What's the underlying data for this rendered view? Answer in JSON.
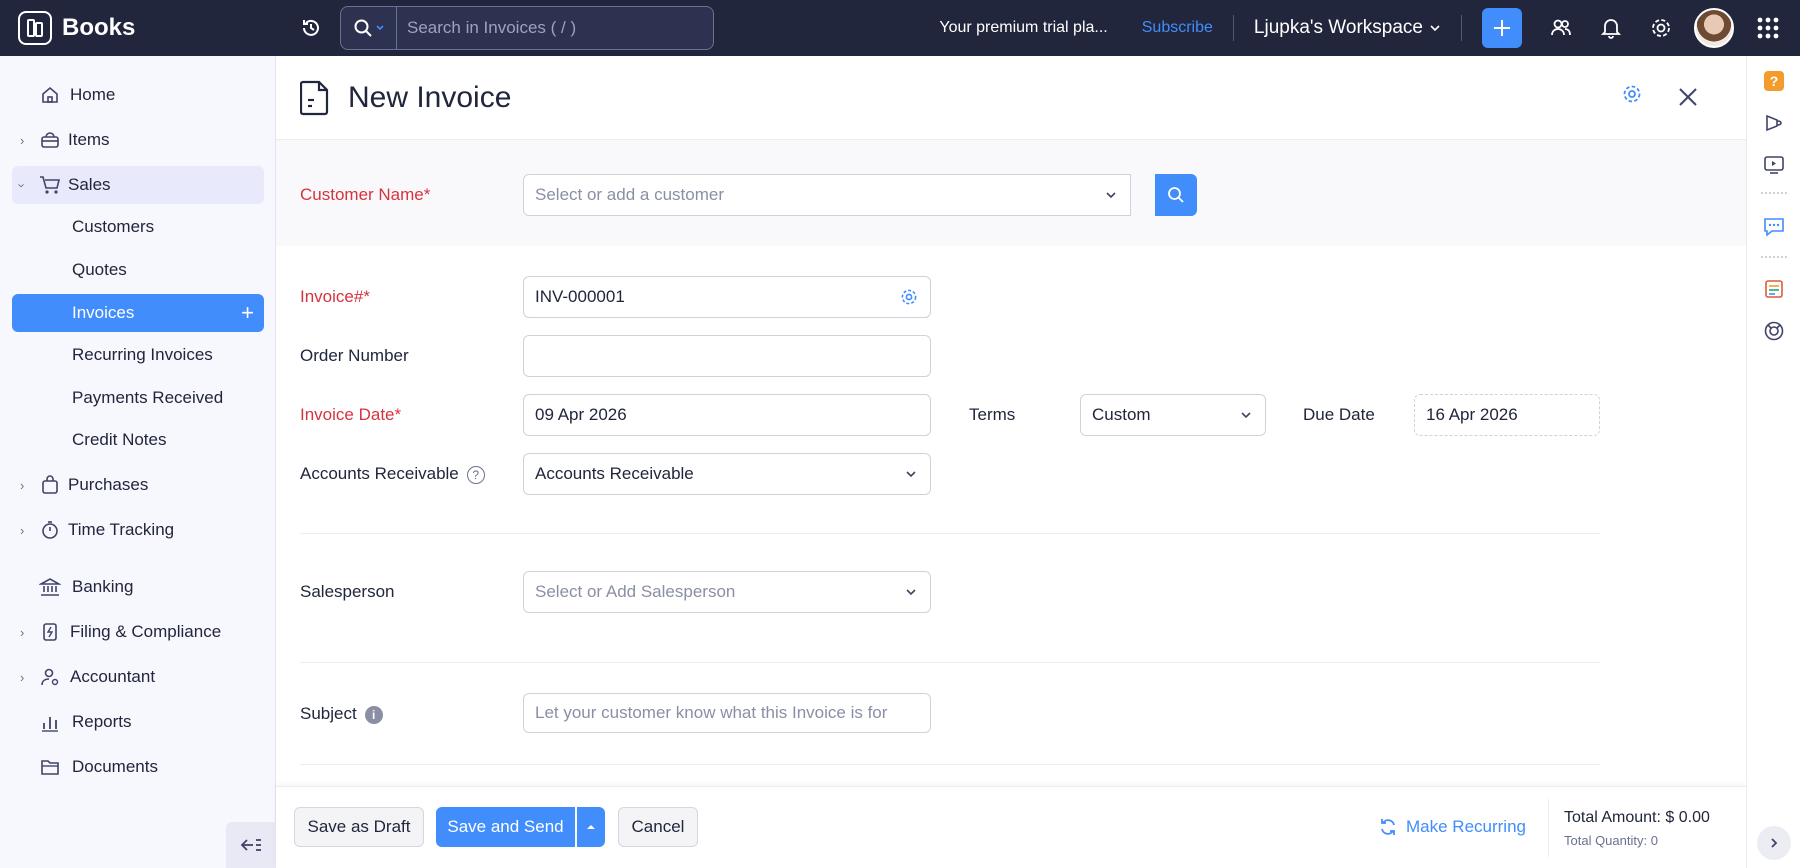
{
  "topbar": {
    "brand": "Books",
    "search_placeholder": "Search in Invoices ( / )",
    "trial_text": "Your premium trial pla...",
    "subscribe": "Subscribe",
    "workspace": "Ljupka's Workspace"
  },
  "sidebar": {
    "home": "Home",
    "items": "Items",
    "sales": "Sales",
    "customers": "Customers",
    "quotes": "Quotes",
    "invoices": "Invoices",
    "recurring_invoices": "Recurring Invoices",
    "payments_received": "Payments Received",
    "credit_notes": "Credit Notes",
    "purchases": "Purchases",
    "time_tracking": "Time Tracking",
    "banking": "Banking",
    "filing": "Filing & Compliance",
    "accountant": "Accountant",
    "reports": "Reports",
    "documents": "Documents"
  },
  "page": {
    "title": "New Invoice"
  },
  "form": {
    "customer_label": "Customer Name*",
    "customer_placeholder": "Select or add a customer",
    "invoice_no_label": "Invoice#*",
    "invoice_no_value": "INV-000001",
    "order_number_label": "Order Number",
    "order_number_value": "",
    "invoice_date_label": "Invoice Date*",
    "invoice_date_value": "09 Apr 2026",
    "terms_label": "Terms",
    "terms_value": "Custom",
    "due_date_label": "Due Date",
    "due_date_value": "16 Apr 2026",
    "ar_label": "Accounts Receivable",
    "ar_value": "Accounts Receivable",
    "salesperson_label": "Salesperson",
    "salesperson_placeholder": "Select or Add Salesperson",
    "subject_label": "Subject",
    "subject_placeholder": "Let your customer know what this Invoice is for"
  },
  "footer": {
    "save_draft": "Save as Draft",
    "save_send": "Save and Send",
    "cancel": "Cancel",
    "make_recurring": "Make Recurring",
    "total_amount": "Total Amount: $ 0.00",
    "total_quantity": "Total Quantity: 0"
  },
  "colors": {
    "accent": "#408dfb",
    "topbar": "#21263c",
    "required": "#d6333f"
  }
}
